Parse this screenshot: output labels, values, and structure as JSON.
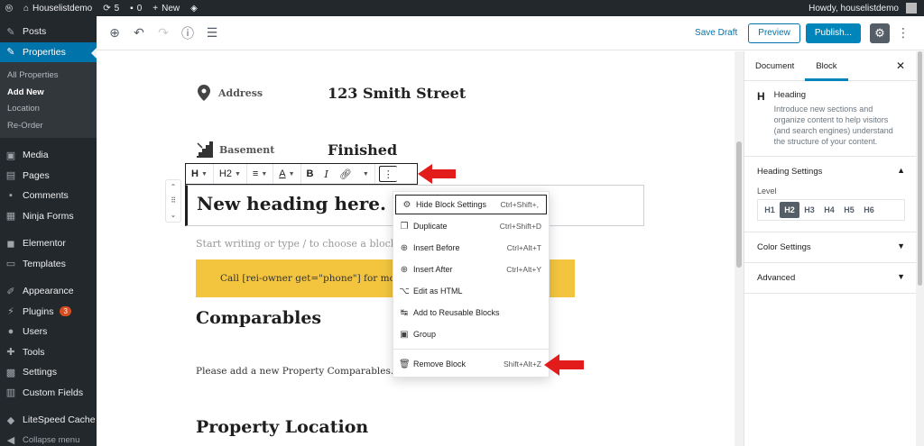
{
  "admin_bar": {
    "site_name": "Houselistdemo",
    "updates_count": "5",
    "comments_count": "0",
    "new_label": "New",
    "howdy": "Howdy, houselistdemo"
  },
  "sidebar": {
    "items_top": [
      {
        "label": "Posts",
        "icon": "pin-icon"
      }
    ],
    "active": {
      "label": "Properties",
      "icon": "pin-icon"
    },
    "submenu": [
      "All Properties",
      "Add New",
      "Location",
      "Re-Order"
    ],
    "submenu_current": "Add New",
    "items_mid": [
      {
        "label": "Media",
        "icon": "media-icon"
      },
      {
        "label": "Pages",
        "icon": "pages-icon"
      },
      {
        "label": "Comments",
        "icon": "comments-icon"
      },
      {
        "label": "Ninja Forms",
        "icon": "forms-icon"
      }
    ],
    "items_mid2": [
      {
        "label": "Elementor",
        "icon": "elementor-icon"
      },
      {
        "label": "Templates",
        "icon": "templates-icon"
      }
    ],
    "items_bottom": [
      {
        "label": "Appearance",
        "icon": "brush-icon"
      },
      {
        "label": "Plugins",
        "icon": "plugin-icon",
        "badge": "3"
      },
      {
        "label": "Users",
        "icon": "users-icon"
      },
      {
        "label": "Tools",
        "icon": "wrench-icon"
      },
      {
        "label": "Settings",
        "icon": "settings-icon"
      },
      {
        "label": "Custom Fields",
        "icon": "fields-icon"
      }
    ],
    "items_last": [
      {
        "label": "LiteSpeed Cache",
        "icon": "litespeed-icon"
      },
      {
        "label": "Collapse menu",
        "icon": "collapse-icon"
      }
    ]
  },
  "editor_header": {
    "save_draft": "Save Draft",
    "preview": "Preview",
    "publish": "Publish..."
  },
  "canvas": {
    "address_label": "Address",
    "address_value": "123 Smith Street",
    "basement_label": "Basement",
    "basement_value": "Finished",
    "heading_text": "New heading here.",
    "placeholder": "Start writing or type / to choose a block",
    "cta_text": "Call [rei-owner get=\"phone\"] for more",
    "comparables_heading": "Comparables",
    "comparables_para": "Please add a new Property Comparables.",
    "location_heading": "Property Location"
  },
  "block_toolbar": {
    "heading_type": "H",
    "level": "H2",
    "align": "≡",
    "text_color": "A",
    "bold": "B",
    "italic": "I"
  },
  "more_menu": {
    "items": [
      {
        "label": "Hide Block Settings",
        "shortcut": "Ctrl+Shift+,",
        "icon": "gear-icon"
      },
      {
        "label": "Duplicate",
        "shortcut": "Ctrl+Shift+D",
        "icon": "duplicate-icon"
      },
      {
        "label": "Insert Before",
        "shortcut": "Ctrl+Alt+T",
        "icon": "insert-before-icon"
      },
      {
        "label": "Insert After",
        "shortcut": "Ctrl+Alt+Y",
        "icon": "insert-after-icon"
      },
      {
        "label": "Edit as HTML",
        "shortcut": "",
        "icon": "html-icon"
      },
      {
        "label": "Add to Reusable Blocks",
        "shortcut": "",
        "icon": "reusable-icon"
      },
      {
        "label": "Group",
        "shortcut": "",
        "icon": "group-icon"
      }
    ],
    "remove": {
      "label": "Remove Block",
      "shortcut": "Shift+Alt+Z",
      "icon": "trash-icon"
    }
  },
  "panel": {
    "tab_document": "Document",
    "tab_block": "Block",
    "block_icon": "H",
    "block_name": "Heading",
    "block_desc": "Introduce new sections and organize content to help visitors (and search engines) understand the structure of your content.",
    "heading_settings": "Heading Settings",
    "level_label": "Level",
    "levels": [
      "H1",
      "H2",
      "H3",
      "H4",
      "H5",
      "H6"
    ],
    "selected_level": "H2",
    "color_settings": "Color Settings",
    "advanced": "Advanced"
  },
  "colors": {
    "admin_dark": "#23282d",
    "wp_blue": "#0073aa",
    "cta_yellow": "#f3c53e",
    "arrow_red": "#e21b1b"
  }
}
